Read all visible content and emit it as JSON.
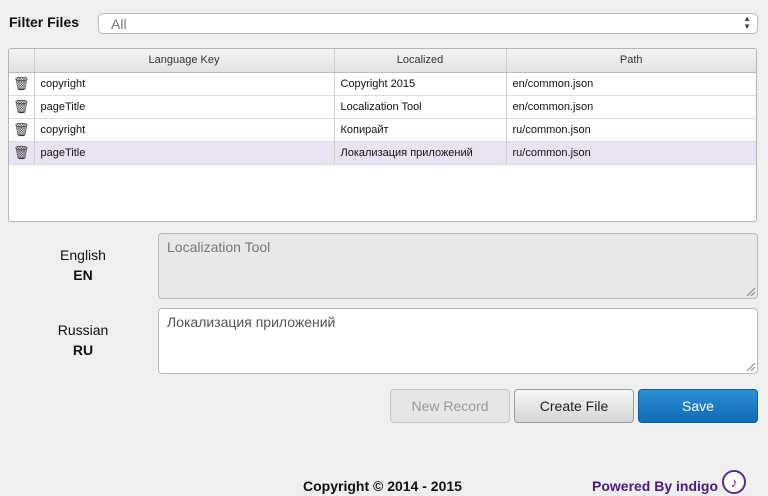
{
  "filter": {
    "label": "Filter Files",
    "selected": "All"
  },
  "table": {
    "headers": [
      "",
      "Language Key",
      "Localized",
      "Path"
    ],
    "rows": [
      {
        "key": "copyright",
        "localized": "Copyright 2015",
        "path": "en/common.json",
        "selected": false
      },
      {
        "key": "pageTitle",
        "localized": "Localization Tool",
        "path": "en/common.json",
        "selected": false
      },
      {
        "key": "copyright",
        "localized": "Копирайт",
        "path": "ru/common.json",
        "selected": false
      },
      {
        "key": "pageTitle",
        "localized": "Локализация приложений",
        "path": "ru/common.json",
        "selected": true
      }
    ],
    "row_icon": "trash-icon"
  },
  "languages": [
    {
      "name": "English",
      "code": "EN",
      "value": "Localization Tool"
    },
    {
      "name": "Russian",
      "code": "RU",
      "value": "Локализация приложений"
    }
  ],
  "buttons": {
    "new_record": "New Record",
    "create_file": "Create File",
    "save": "Save"
  },
  "footer": {
    "copyright": "Copyright © 2014 - 2015",
    "powered_by": "Powered By indigo"
  },
  "colors": {
    "accent": "#1a7bc8",
    "selected_row": "#e9e3f4",
    "brand": "#4a1a82"
  }
}
